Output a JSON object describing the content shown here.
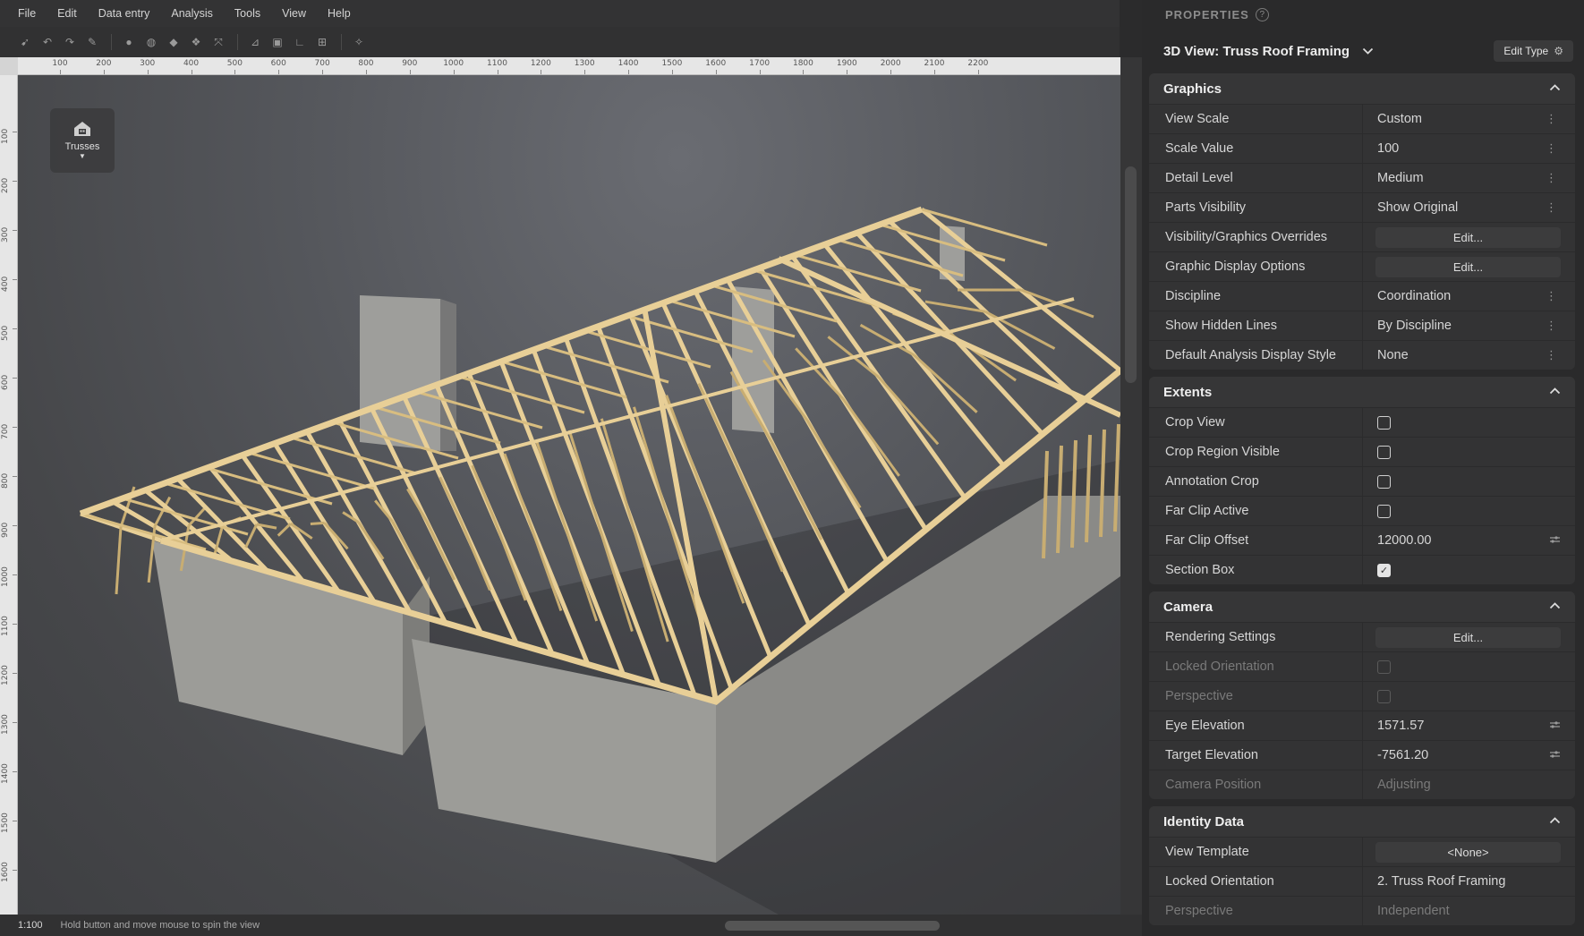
{
  "menu": [
    "File",
    "Edit",
    "Data entry",
    "Analysis",
    "Tools",
    "View",
    "Help"
  ],
  "toolbar_icons": [
    [
      "select-icon",
      "undo-icon",
      "redo-icon",
      "pencil-icon"
    ],
    [
      "sphere-icon",
      "globe-icon",
      "shapes-icon",
      "group-icon",
      "expand-icon"
    ],
    [
      "measure-icon",
      "frame-icon",
      "angle-icon",
      "section-icon"
    ],
    [
      "magic-wand-icon"
    ]
  ],
  "ruler": {
    "h_ticks": [
      "100",
      "200",
      "300",
      "400",
      "500",
      "600",
      "700",
      "800",
      "900",
      "1000",
      "1100",
      "1200",
      "1300",
      "1400",
      "1500",
      "1600",
      "1700",
      "1800",
      "1900",
      "2000",
      "2100",
      "2200"
    ],
    "v_ticks": [
      "100",
      "200",
      "300",
      "400",
      "500",
      "600",
      "700",
      "800",
      "900",
      "1000",
      "1100",
      "1200",
      "1300",
      "1400",
      "1500",
      "1600"
    ]
  },
  "viewport": {
    "chip_label": "Trusses",
    "chip_icon": "house-icon"
  },
  "status": {
    "scale": "1:100",
    "hint": "Hold button and move mouse to spin the view"
  },
  "panel": {
    "title": "PROPERTIES",
    "type_name": "3D View: Truss Roof Framing",
    "edit_type_label": "Edit Type",
    "sections": [
      {
        "title": "Graphics",
        "rows": [
          {
            "label": "View Scale",
            "value": "Custom",
            "kind": "dropdown"
          },
          {
            "label": "Scale Value",
            "value": "100",
            "kind": "dropdown"
          },
          {
            "label": "Detail Level",
            "value": "Medium",
            "kind": "dropdown"
          },
          {
            "label": "Parts Visibility",
            "value": "Show Original",
            "kind": "dropdown"
          },
          {
            "label": "Visibility/Graphics Overrides",
            "value": "Edit...",
            "kind": "button"
          },
          {
            "label": "Graphic Display Options",
            "value": "Edit...",
            "kind": "button"
          },
          {
            "label": "Discipline",
            "value": "Coordination",
            "kind": "dropdown"
          },
          {
            "label": "Show Hidden Lines",
            "value": "By Discipline",
            "kind": "dropdown"
          },
          {
            "label": "Default Analysis Display Style",
            "value": "None",
            "kind": "dropdown"
          }
        ]
      },
      {
        "title": "Extents",
        "rows": [
          {
            "label": "Crop View",
            "kind": "checkbox",
            "checked": false
          },
          {
            "label": "Crop Region Visible",
            "kind": "checkbox",
            "checked": false
          },
          {
            "label": "Annotation Crop",
            "kind": "checkbox",
            "checked": false
          },
          {
            "label": "Far Clip Active",
            "kind": "checkbox",
            "checked": false
          },
          {
            "label": "Far Clip Offset",
            "value": "12000.00",
            "kind": "number"
          },
          {
            "label": "Section Box",
            "kind": "checkbox",
            "checked": true
          }
        ]
      },
      {
        "title": "Camera",
        "rows": [
          {
            "label": "Rendering Settings",
            "value": "Edit...",
            "kind": "button"
          },
          {
            "label": "Locked Orientation",
            "kind": "checkbox",
            "checked": false,
            "disabled": true
          },
          {
            "label": "Perspective",
            "kind": "checkbox",
            "checked": false,
            "disabled": true
          },
          {
            "label": "Eye Elevation",
            "value": "1571.57",
            "kind": "number"
          },
          {
            "label": "Target Elevation",
            "value": "-7561.20",
            "kind": "number"
          },
          {
            "label": "Camera Position",
            "value": "Adjusting",
            "kind": "text",
            "disabled": true
          }
        ]
      },
      {
        "title": "Identity Data",
        "rows": [
          {
            "label": "View Template",
            "value": "<None>",
            "kind": "button"
          },
          {
            "label": "Locked Orientation",
            "value": "2. Truss Roof Framing",
            "kind": "text"
          },
          {
            "label": "Perspective",
            "value": "Independent",
            "kind": "text",
            "disabled": true
          }
        ]
      }
    ]
  },
  "colors": {
    "truss": "#e8cf97",
    "wall": "#9c9c98",
    "panel_bg": "#2a2a2b",
    "section_bg": "#333334"
  }
}
